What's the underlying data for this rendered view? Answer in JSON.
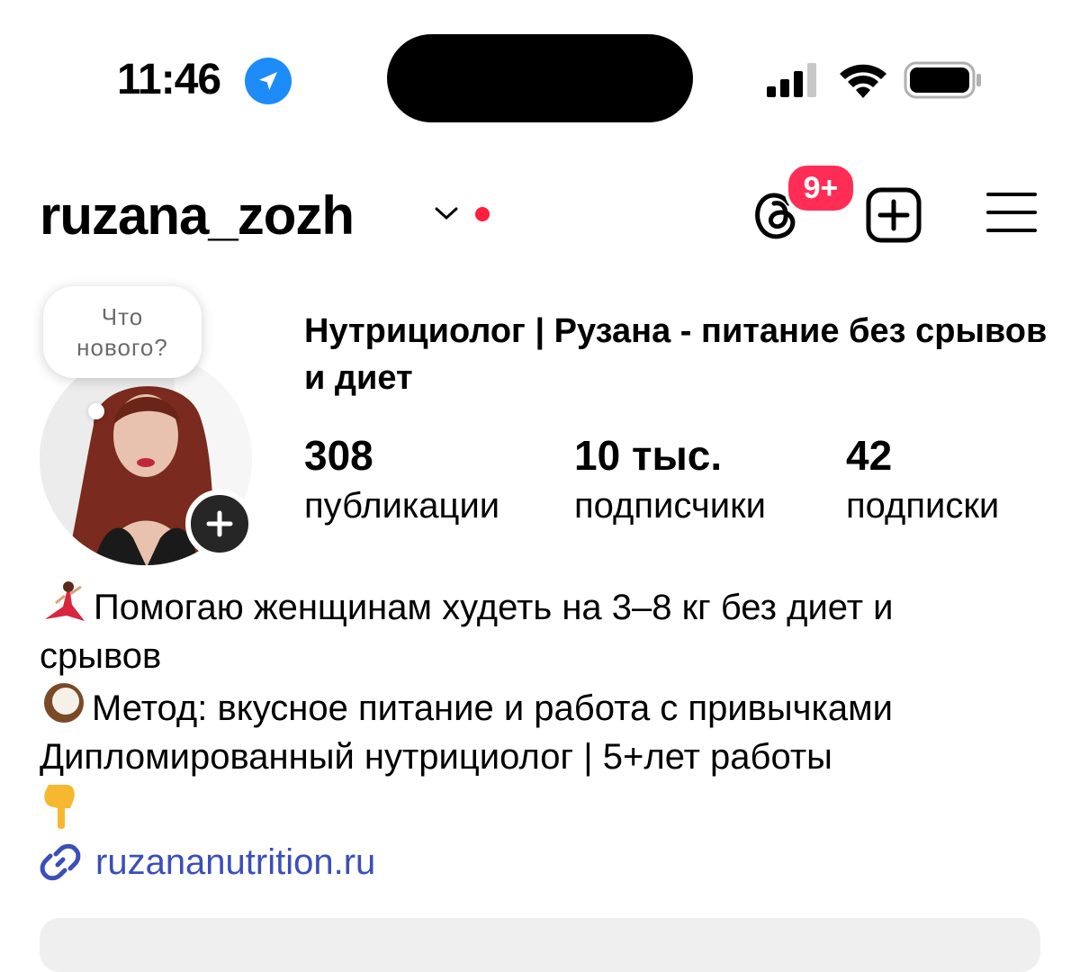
{
  "status_bar": {
    "time": "11:46",
    "icons": [
      "location-arrow-icon",
      "cellular-signal-icon",
      "wifi-icon",
      "battery-icon"
    ]
  },
  "header": {
    "username": "ruzana_zozh",
    "notification_badge": "9+",
    "icons": [
      "chevron-down-icon",
      "threads-icon",
      "add-post-icon",
      "menu-icon"
    ],
    "accent_red": "#ff2d55"
  },
  "profile": {
    "note_bubble": [
      "Что",
      "нового?"
    ],
    "display_name": "Нутрициолог | Рузана - питание без срывов и диет",
    "stats": [
      {
        "value": "308",
        "label": "публикации"
      },
      {
        "value": "10 тыс.",
        "label": "подписчики"
      },
      {
        "value": "42",
        "label": "подписки"
      }
    ],
    "bio": {
      "line1": "Помогаю женщинам худеть на 3–8 кг без диет и",
      "line2": "срывов",
      "line3": "Метод: вкусное питание и работа с привычками",
      "line4": "Дипломированный нутрициолог | 5+лет работы",
      "emoji": [
        "dancer-emoji",
        "coconut-emoji",
        "pointing-down-emoji"
      ]
    },
    "link": "ruzananutrition.ru",
    "link_color": "#3b4fb8"
  }
}
